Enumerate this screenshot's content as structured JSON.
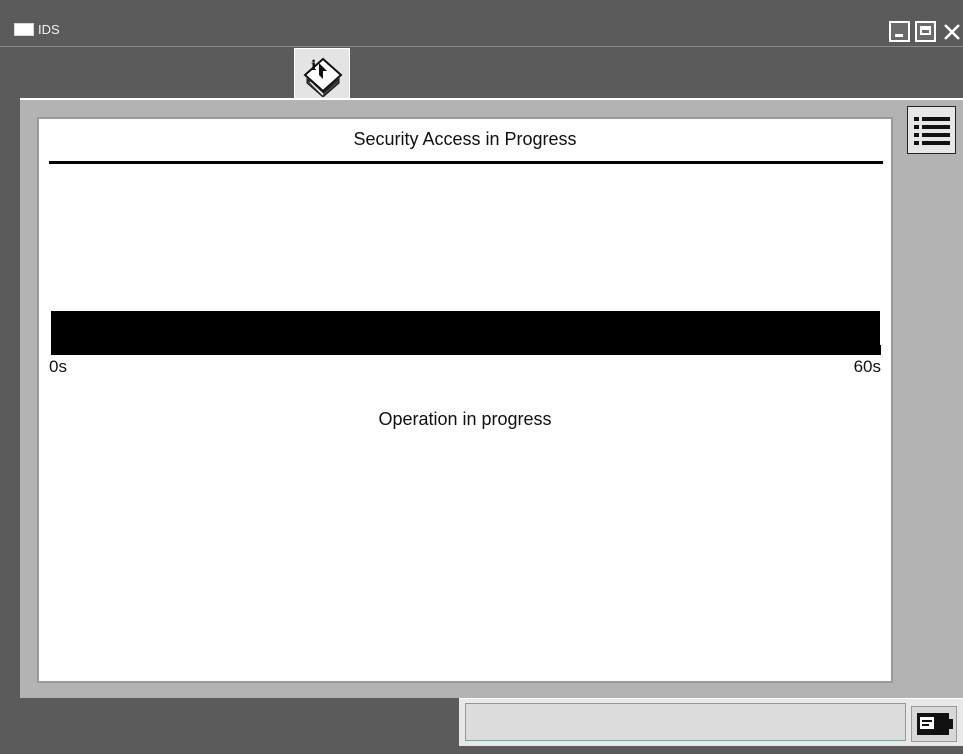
{
  "window": {
    "title": "IDS",
    "controls": [
      "minimize-icon",
      "maximize-icon",
      "close-icon"
    ]
  },
  "tabs": [
    {
      "icon": "info-book-icon",
      "active": true
    }
  ],
  "main": {
    "heading": "Security Access in Progress",
    "progress": {
      "value": 1.0,
      "min_label": "0s",
      "max_label": "60s"
    },
    "status": "Operation in progress"
  },
  "toolbar": {
    "list_icon": "list-menu-icon"
  },
  "statusbar": {
    "value": "",
    "icon": "battery-icon"
  },
  "colors": {
    "background": "#5b5b5b",
    "panel": "#b3b3b3",
    "progress_fill": "#000000"
  }
}
